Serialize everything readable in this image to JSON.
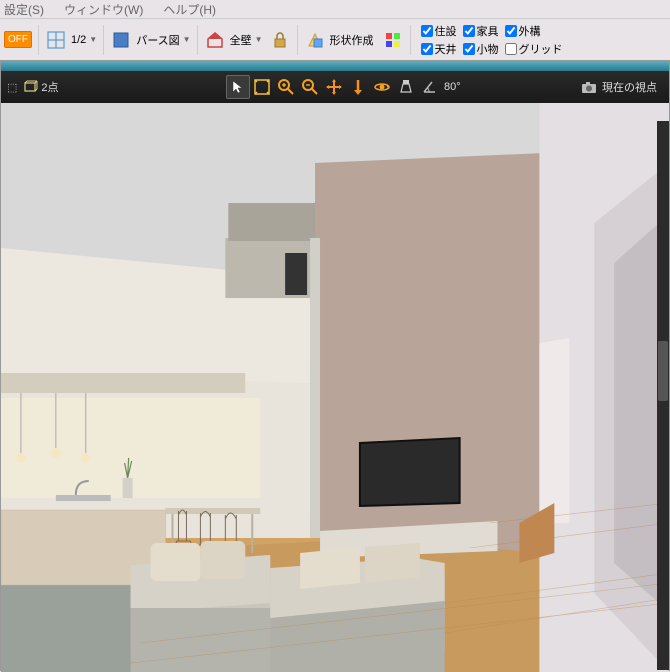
{
  "menu": {
    "settings": "設定(S)",
    "window": "ウィンドウ(W)",
    "help": "ヘルプ(H)"
  },
  "toolbar": {
    "off": "OFF",
    "half": "1/2",
    "perspective": "パース図",
    "allwalls": "全壁",
    "shape": "形状作成"
  },
  "checks": {
    "equipment": "住設",
    "furniture": "家具",
    "exterior": "外構",
    "ceiling": "天井",
    "accessories": "小物",
    "grid": "グリッド"
  },
  "secondbar": {
    "twopoint": "2点",
    "angle": "80°",
    "viewpoint": "現在の視点"
  }
}
